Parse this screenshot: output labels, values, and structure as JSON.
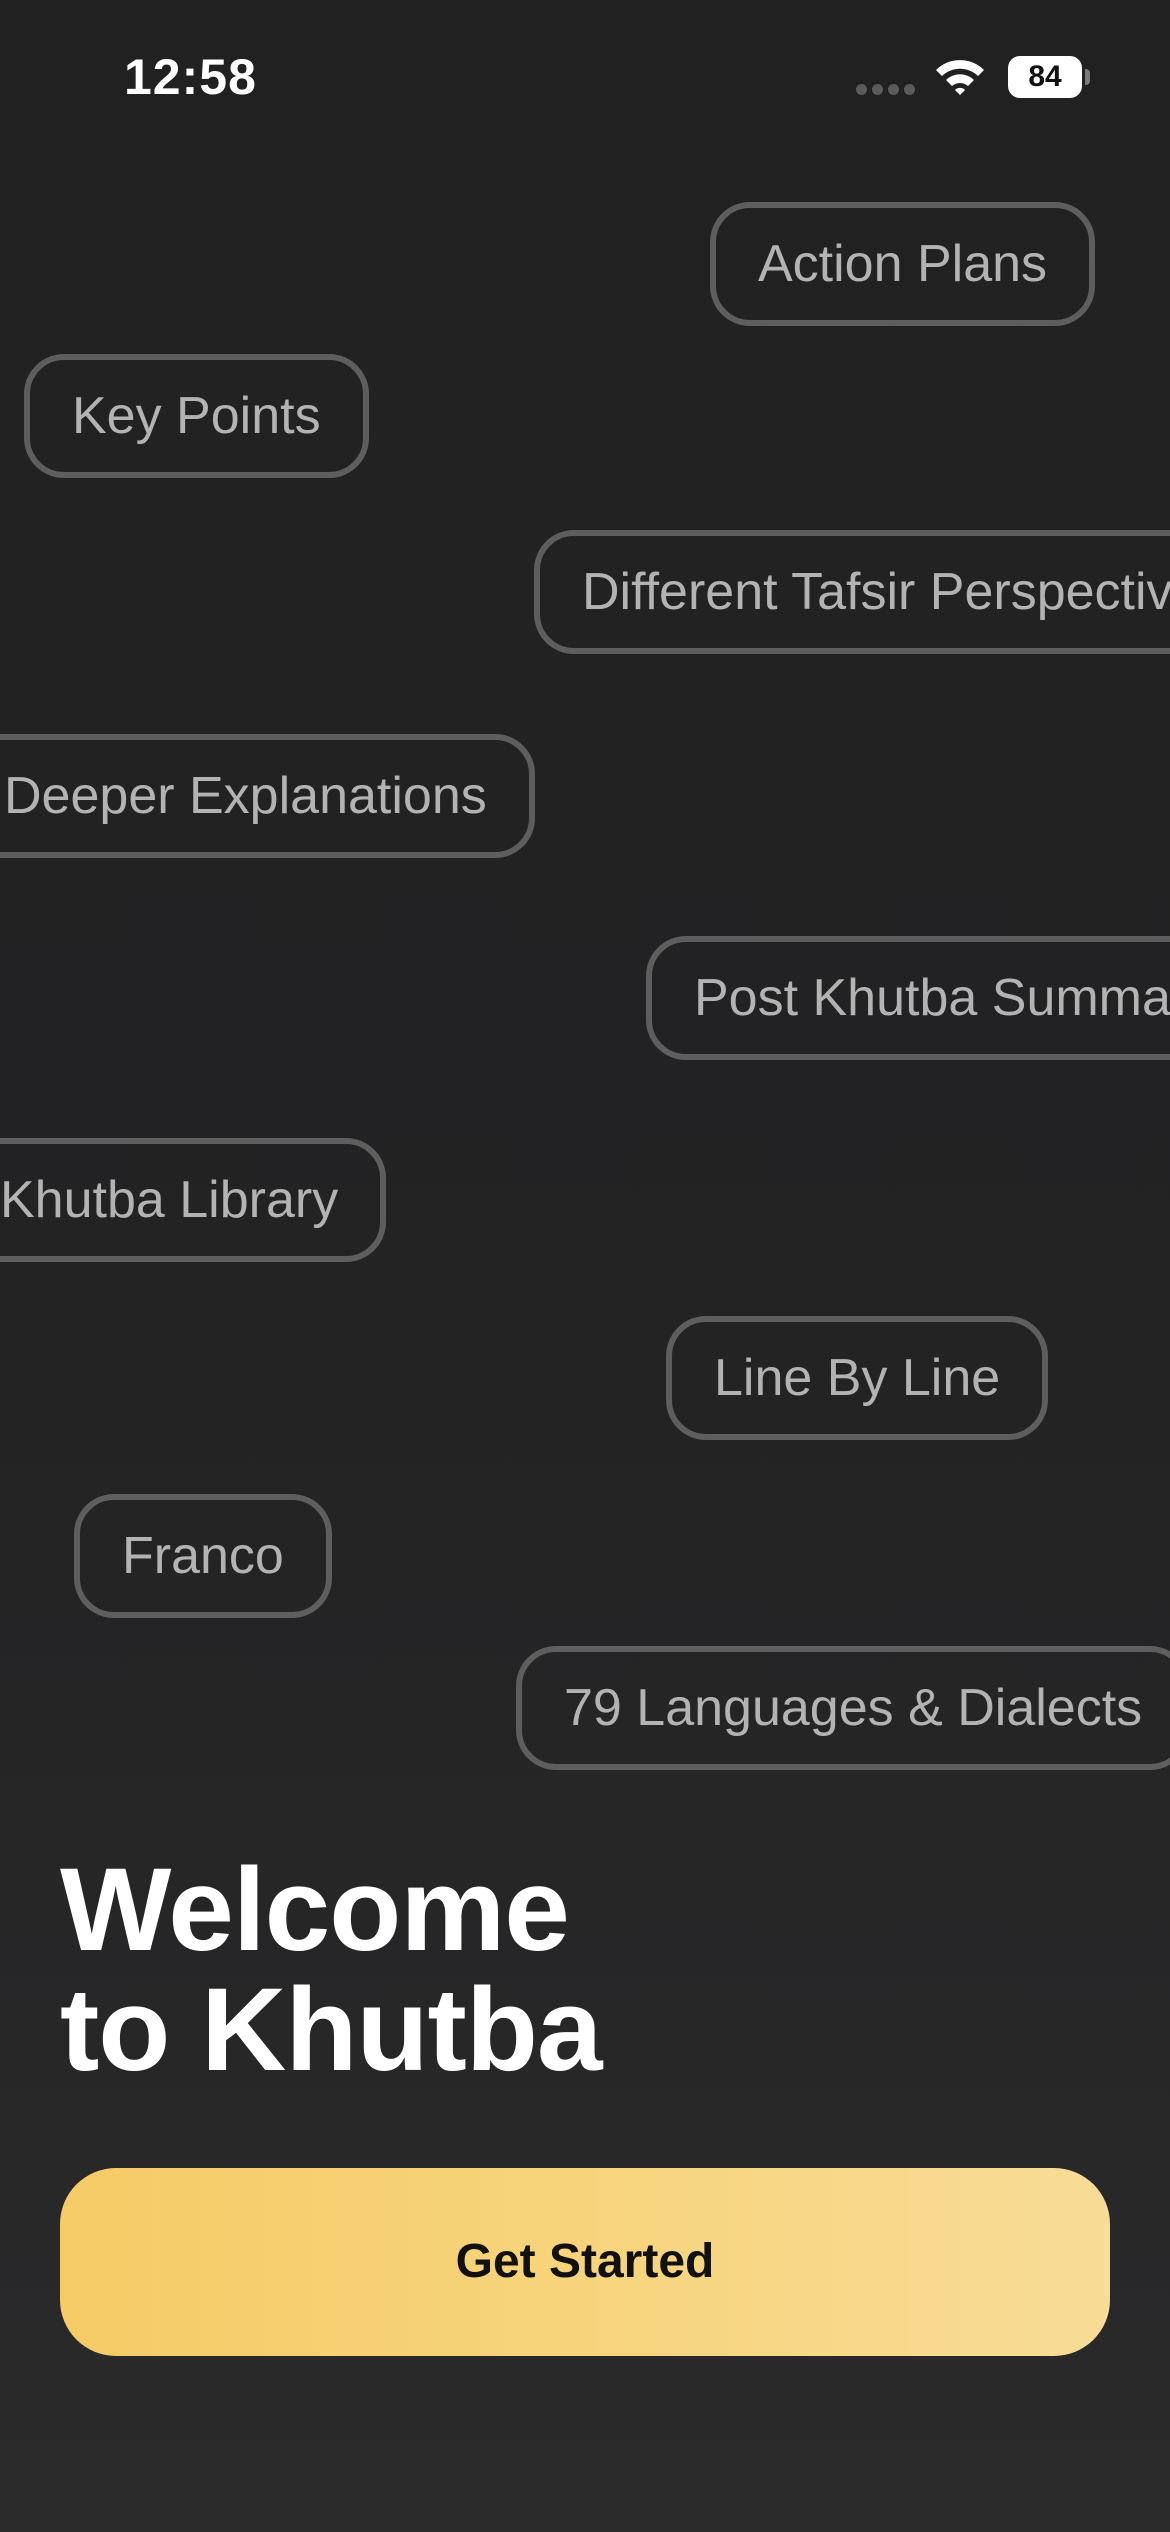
{
  "status_bar": {
    "time": "12:58",
    "battery": "84"
  },
  "feature_chips": [
    "Action Plans",
    "Key Points",
    "Different Tafsir Perspectives",
    "Deeper Explanations",
    "Post Khutba Summary",
    "Khutba Library",
    "Line By Line",
    "Franco",
    "79 Languages & Dialects"
  ],
  "welcome": {
    "line1": "Welcome",
    "line2": "to Khutba"
  },
  "cta": {
    "label": "Get Started"
  },
  "colors": {
    "background": "#222223",
    "chip_border": "#5e5e5f",
    "chip_text": "#b3b3b3",
    "cta_gradient_start": "#f5cb66",
    "cta_gradient_end": "#f8dc97"
  }
}
